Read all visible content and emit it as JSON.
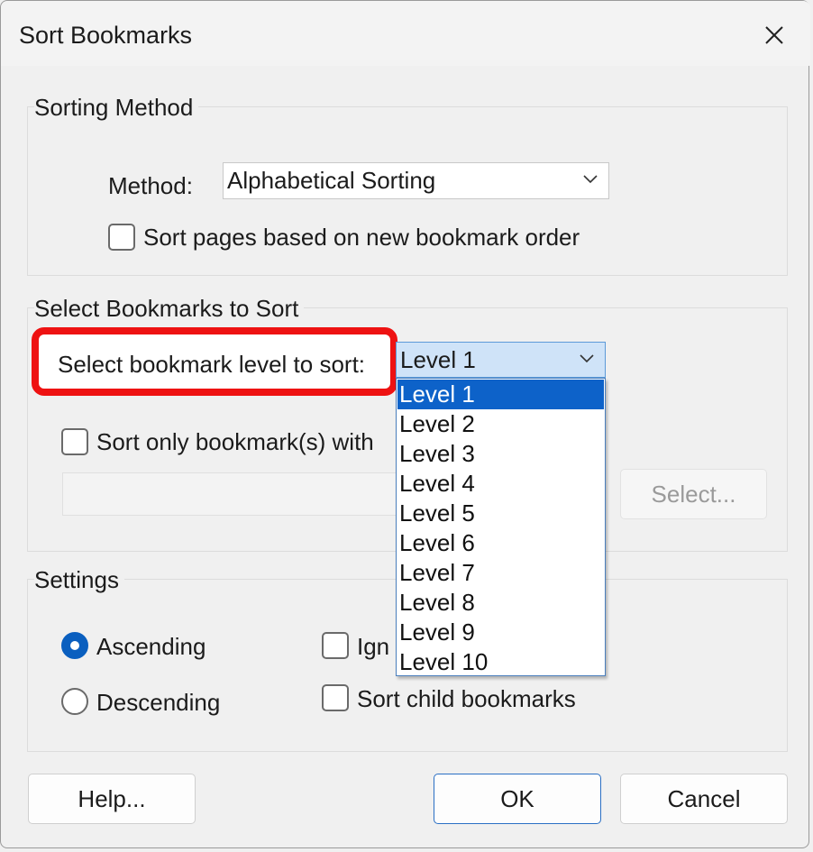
{
  "dialog": {
    "title": "Sort Bookmarks",
    "close_icon": "close-icon"
  },
  "sorting_method": {
    "group_label": "Sorting Method",
    "method_label": "Method:",
    "method_value": "Alphabetical Sorting",
    "sort_pages_label": "Sort pages based on new bookmark order",
    "sort_pages_checked": false
  },
  "select_bookmarks": {
    "group_label": "Select Bookmarks to Sort",
    "level_label": "Select bookmark level to sort:",
    "level_value": "Level 1",
    "level_options": [
      "Level 1",
      "Level 2",
      "Level 3",
      "Level 4",
      "Level 5",
      "Level 6",
      "Level 7",
      "Level 8",
      "Level 9",
      "Level 10"
    ],
    "selected_index": 0,
    "sort_only_label": "Sort only bookmark(s) with",
    "sort_only_checked": false,
    "text_value": "",
    "select_button": "Select..."
  },
  "settings": {
    "group_label": "Settings",
    "ascending_label": "Ascending",
    "descending_label": "Descending",
    "order": "ascending",
    "ignore_label_partial": "Ign",
    "sort_child_label": "Sort child bookmarks"
  },
  "buttons": {
    "help": "Help...",
    "ok": "OK",
    "cancel": "Cancel"
  },
  "colors": {
    "highlight": "#ee1212",
    "accent": "#0d62c9"
  }
}
